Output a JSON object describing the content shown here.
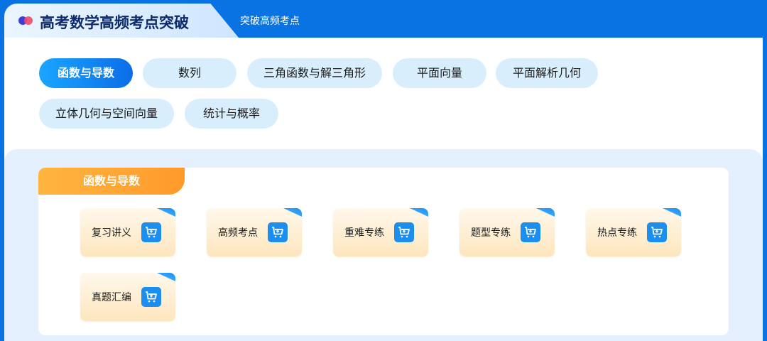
{
  "header": {
    "title": "高考数学高频考点突破",
    "subtab": "突破高频考点"
  },
  "topics": [
    {
      "label": "函数与导数",
      "active": true
    },
    {
      "label": "数列"
    },
    {
      "label": "三角函数与解三角形"
    },
    {
      "label": "平面向量"
    },
    {
      "label": "平面解析几何"
    },
    {
      "label": "立体几何与空间向量"
    },
    {
      "label": "统计与概率"
    }
  ],
  "section": {
    "title": "函数与导数",
    "tiles": [
      {
        "label": "复习讲义",
        "icon": "cart-plus-icon"
      },
      {
        "label": "高频考点",
        "icon": "cart-plus-icon"
      },
      {
        "label": "重难专练",
        "icon": "cart-plus-icon"
      },
      {
        "label": "题型专练",
        "icon": "cart-plus-icon"
      },
      {
        "label": "热点专练",
        "icon": "cart-plus-icon"
      },
      {
        "label": "真题汇编",
        "icon": "cart-plus-icon"
      }
    ]
  },
  "colors": {
    "header_blue": "#0a73e4",
    "chip_bg": "#d9eefd",
    "active_chip": "#0b6de8",
    "section_orange": "#ff9a2a",
    "cart_blue": "#1c8ef0"
  }
}
